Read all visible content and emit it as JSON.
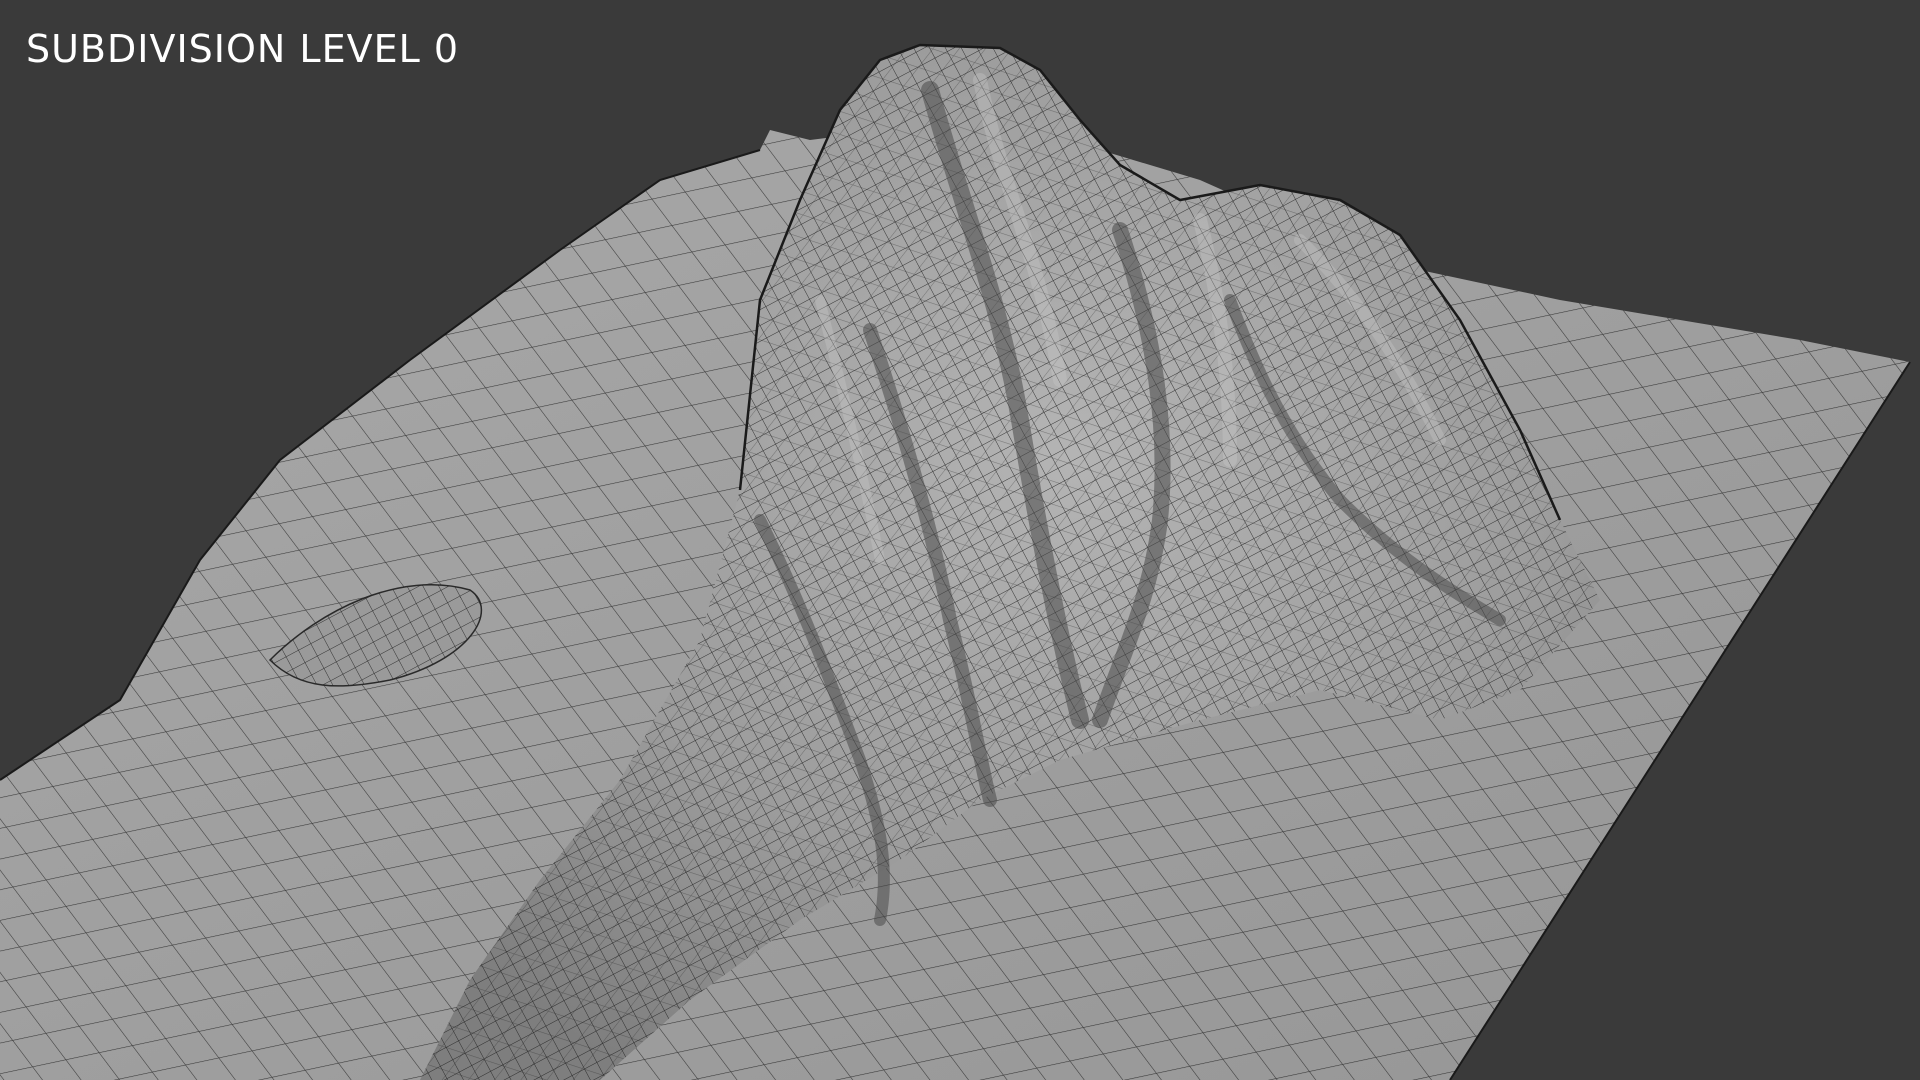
{
  "viewport": {
    "overlay_label": "SUBDIVISION LEVEL 0",
    "background_color": "#3a3a3a",
    "mesh_color": "#a2a2a2",
    "wire_color": "#1e1e1e"
  }
}
